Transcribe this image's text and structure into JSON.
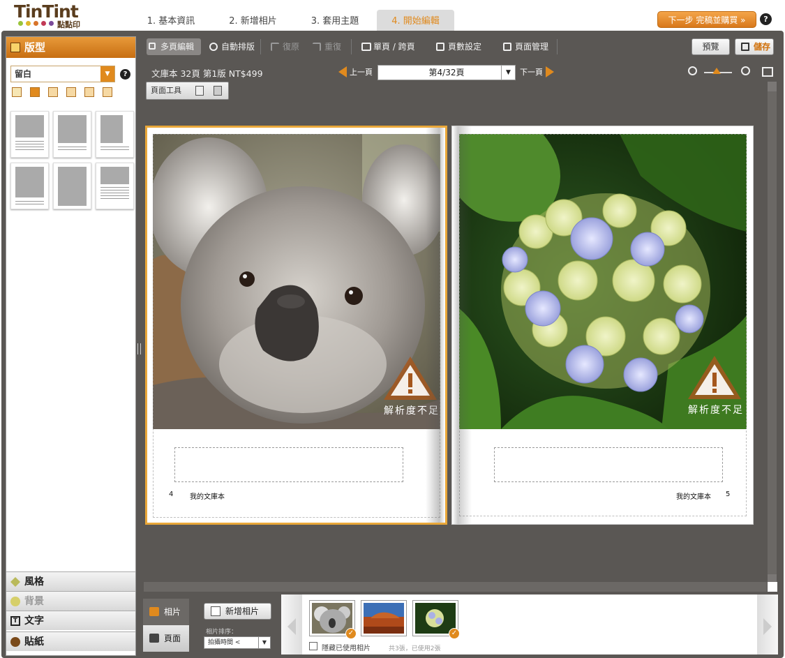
{
  "header": {
    "logo_text": "TinTint",
    "logo_sub": "點點印",
    "steps": [
      "1. 基本資訊",
      "2. 新增相片",
      "3. 套用主題",
      "4. 開始編輯"
    ],
    "next_button": "下一步 完稿並購買 »",
    "help": "?"
  },
  "left_panel": {
    "title": "版型",
    "layout_select": "留白",
    "help": "?",
    "tabs": [
      "風格",
      "背景",
      "文字",
      "貼紙"
    ]
  },
  "toolbar": {
    "multi_page": "多頁編輯",
    "auto_layout": "自動排版",
    "undo": "復原",
    "redo": "重復",
    "single_spread": "單頁 / 跨頁",
    "page_count": "頁數設定",
    "page_manage": "頁面管理",
    "preview": "預覽",
    "save": "儲存"
  },
  "book_info": "文庫本 32頁 第1版 NT$499",
  "navigation": {
    "prev": "上一頁",
    "current": "第4/32頁",
    "next": "下一頁"
  },
  "zoom_level": 0.45,
  "page_tools": "頁面工具",
  "spread": {
    "left_page": {
      "number": "4",
      "title": "我的文庫本",
      "warning": "解析度不足"
    },
    "right_page": {
      "number": "5",
      "title": "我的文庫本",
      "warning": "解析度不足"
    }
  },
  "bottom": {
    "tab_photos": "相片",
    "tab_pages": "頁面",
    "add_photo": "新增相片",
    "sort_label": "相片排序：",
    "sort_value": "拍攝時間 <",
    "hide_used": "隱藏已使用相片",
    "count_info": "共3張，已使用2張"
  },
  "colors": {
    "accent": "#e08a1e",
    "frame": "#5a5754"
  }
}
